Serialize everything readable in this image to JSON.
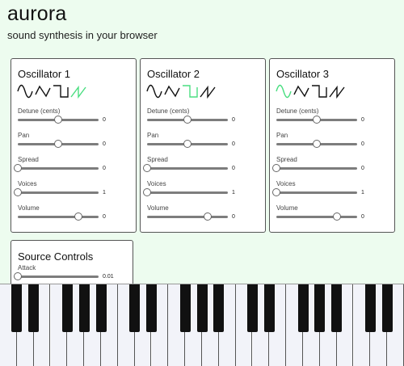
{
  "app": {
    "title": "aurora",
    "subtitle": "sound synthesis in your browser"
  },
  "colors": {
    "active_waveform": "#4ade80",
    "inactive_waveform": "#111111",
    "background": "#edfcef"
  },
  "oscillators": [
    {
      "title": "Oscillator 1",
      "waveforms": [
        {
          "name": "sine-wave-icon",
          "active": false
        },
        {
          "name": "triangle-wave-icon",
          "active": false
        },
        {
          "name": "square-wave-icon",
          "active": false
        },
        {
          "name": "sawtooth-wave-icon",
          "active": true
        }
      ],
      "params": [
        {
          "label": "Detune (cents)",
          "value": "0",
          "level": 0.5
        },
        {
          "label": "Pan",
          "value": "0",
          "level": 0.5
        },
        {
          "label": "Spread",
          "value": "0",
          "level": 0.0
        },
        {
          "label": "Voices",
          "value": "1",
          "level": 0.0
        },
        {
          "label": "Volume",
          "value": "0",
          "level": 0.75
        }
      ]
    },
    {
      "title": "Oscillator 2",
      "waveforms": [
        {
          "name": "sine-wave-icon",
          "active": false
        },
        {
          "name": "triangle-wave-icon",
          "active": false
        },
        {
          "name": "square-wave-icon",
          "active": true
        },
        {
          "name": "sawtooth-wave-icon",
          "active": false
        }
      ],
      "params": [
        {
          "label": "Detune (cents)",
          "value": "0",
          "level": 0.5
        },
        {
          "label": "Pan",
          "value": "0",
          "level": 0.5
        },
        {
          "label": "Spread",
          "value": "0",
          "level": 0.0
        },
        {
          "label": "Voices",
          "value": "1",
          "level": 0.0
        },
        {
          "label": "Volume",
          "value": "0",
          "level": 0.75
        }
      ]
    },
    {
      "title": "Oscillator 3",
      "waveforms": [
        {
          "name": "sine-wave-icon",
          "active": true
        },
        {
          "name": "triangle-wave-icon",
          "active": false
        },
        {
          "name": "square-wave-icon",
          "active": false
        },
        {
          "name": "sawtooth-wave-icon",
          "active": false
        }
      ],
      "params": [
        {
          "label": "Detune (cents)",
          "value": "0",
          "level": 0.5
        },
        {
          "label": "Pan",
          "value": "0",
          "level": 0.5
        },
        {
          "label": "Spread",
          "value": "0",
          "level": 0.0
        },
        {
          "label": "Voices",
          "value": "1",
          "level": 0.0
        },
        {
          "label": "Volume",
          "value": "0",
          "level": 0.75
        }
      ]
    }
  ],
  "source_controls": {
    "title": "Source Controls",
    "params": [
      {
        "label": "Attack",
        "value": "0.01",
        "level": 0.0
      }
    ]
  },
  "keyboard": {
    "white_keys": 24,
    "black_keys_after_white": [
      0,
      1,
      3,
      4,
      5,
      7,
      8,
      10,
      11,
      12,
      14,
      15,
      17,
      18,
      19,
      21,
      22
    ]
  }
}
